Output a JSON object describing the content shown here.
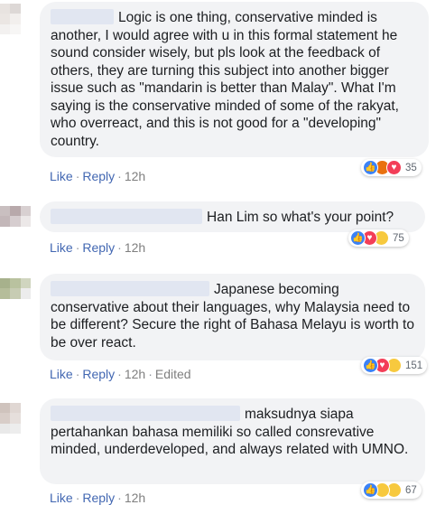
{
  "comments": [
    {
      "text": "Logic is one thing, conservative minded is another, I would agree with u in this formal statement he sound consider wisely, but pls look at the feedback of others, they are turning this subject into another bigger issue such as \"mandarin is better than Malay\". What I'm saying is the conservative minded of some of the rakyat, who overreact, and this is not good for a \"developing\" country.",
      "like": "Like",
      "reply": "Reply",
      "time": "12h",
      "edited": "",
      "reaction_count": "35",
      "reactions": [
        "like-icon",
        "angry-icon",
        "love-icon"
      ]
    },
    {
      "text": "Han Lim so what's your point?",
      "like": "Like",
      "reply": "Reply",
      "time": "12h",
      "edited": "",
      "reaction_count": "75",
      "reactions": [
        "like-icon",
        "love-icon",
        "haha-icon"
      ]
    },
    {
      "text": "Japanese becoming conservative about their languages, why Malaysia need to be different? Secure the right of Bahasa Melayu is worth to be over react.",
      "like": "Like",
      "reply": "Reply",
      "time": "12h",
      "edited": "Edited",
      "reaction_count": "151",
      "reactions": [
        "like-icon",
        "love-icon",
        "wow-icon"
      ]
    },
    {
      "text": "maksudnya siapa pertahankan bahasa memiliki so called consrevative minded, underdeveloped, and always related with UMNO.",
      "like": "Like",
      "reply": "Reply",
      "time": "12h",
      "edited": "",
      "reaction_count": "67",
      "reactions": [
        "like-icon",
        "haha-icon",
        "sad-icon"
      ]
    }
  ]
}
